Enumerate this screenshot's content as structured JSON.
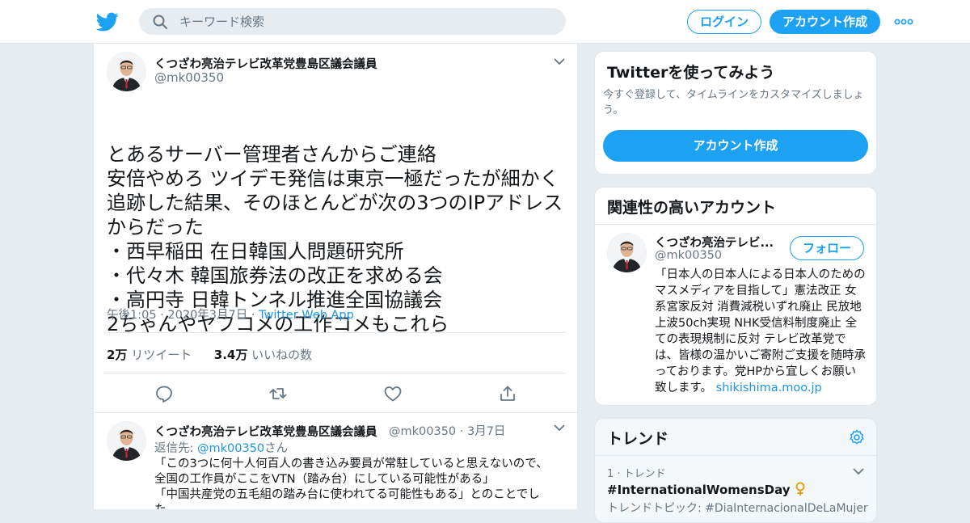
{
  "header": {
    "search_placeholder": "キーワード検索",
    "login_label": "ログイン",
    "signup_label": "アカウント作成"
  },
  "tweet": {
    "author_name": "くつざわ亮治テレビ改革党豊島区議会議員",
    "author_handle": "@mk00350",
    "lines": [
      "とあるサーバー管理者さんからご連絡",
      "安倍やめろ ツイデモ発信は東京一極だったが細かく",
      "追跡した結果、そのほとんどが次の3つのIPアドレス",
      "からだった",
      "・西早稲田 在日韓国人問題研究所",
      "・代々木 韓国旅券法の改正を求める会",
      "・高円寺 日韓トンネル推進全国協議会",
      "2ちゃんやヤフコメの工作コメもこれら"
    ],
    "timestamp": "午後1:05 · 2020年3月7日 ·",
    "source": "Twitter Web App",
    "retweet_count": "2万",
    "retweet_label": "リツイート",
    "like_count": "3.4万",
    "like_label": "いいねの数"
  },
  "reply": {
    "author_name": "くつざわ亮治テレビ改革党豊島区議会議員",
    "author_handle": "@mk00350",
    "date": "· 3月7日",
    "replying_prefix": "返信先:",
    "replying_to": "@mk00350",
    "replying_suffix": "さん",
    "lines": [
      "「この3つに何十人何百人の書き込み要員が常駐していると思えないので、",
      "全国の工作員がここをVTN（踏み台）にしている可能性がある」",
      "「中国共産党の五毛組の踏み台に使われてる可能性もある」とのことでし",
      "た"
    ]
  },
  "signup_card": {
    "title": "Twitterを使ってみよう",
    "desc": "今すぐ登録して、タイムラインをカスタマイズしましょう。",
    "button": "アカウント作成"
  },
  "related_card": {
    "title": "関連性の高いアカウント",
    "name": "くつざわ亮治テレビ...",
    "handle": "@mk00350",
    "follow": "フォロー",
    "bio": "「日本人の日本人による日本人のためのマスメディアを目指して」憲法改正 女系宮家反対 消費減税いずれ廃止 民放地上波50ch実現 NHK受信料制度廃止 全ての表現規制に反対 テレビ改革党では、皆様の温かいご寄附ご支援を随時承っております。党HPから宜しくお願い致します。",
    "bio_link": "shikishima.moo.jp"
  },
  "trends_card": {
    "title": "トレンド",
    "rank": "1 · トレンド",
    "name": "#InternationalWomensDay",
    "sub": "トレンドトピック: #DiaInternacionalDeLaMujer"
  },
  "colors": {
    "accent": "#1da1f2",
    "background": "#e6ecf0",
    "text": "#14171a",
    "muted": "#657786"
  }
}
